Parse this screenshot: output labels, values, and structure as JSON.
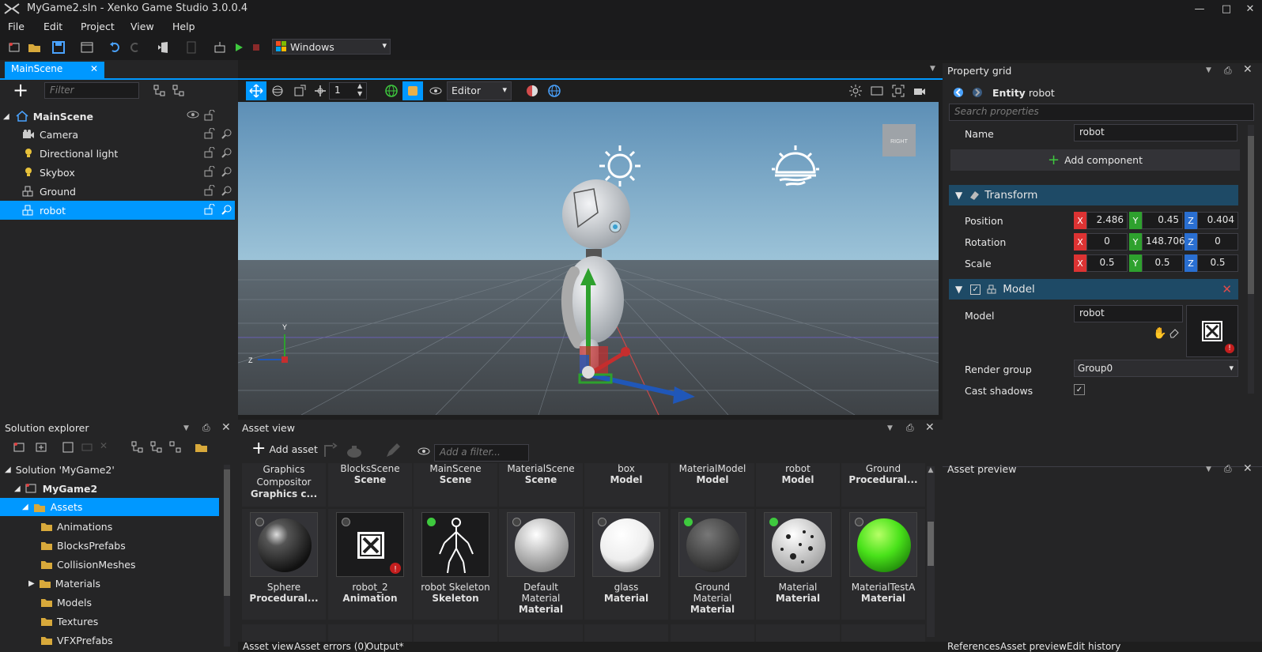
{
  "window": {
    "title": "MyGame2.sln - Xenko Game Studio 3.0.0.4"
  },
  "menu": [
    "File",
    "Edit",
    "Project",
    "View",
    "Help"
  ],
  "toolbar": {
    "platform": "Windows"
  },
  "doc_tab": {
    "label": "MainScene"
  },
  "scene_tree": {
    "filter_placeholder": "Filter",
    "root": "MainScene",
    "items": [
      "Camera",
      "Directional light",
      "Skybox",
      "Ground",
      "robot"
    ]
  },
  "viewport": {
    "grid_step": "1",
    "camera_mode": "Editor",
    "view_cube": "RIGHT",
    "gizmo": {
      "y": "Y",
      "z": "Z"
    }
  },
  "property_grid": {
    "title": "Property grid",
    "entity_label": "Entity",
    "entity_name": "robot",
    "search_placeholder": "Search properties",
    "name_label": "Name",
    "name_value": "robot",
    "add_component": "Add component",
    "transform": {
      "title": "Transform",
      "position_label": "Position",
      "rotation_label": "Rotation",
      "scale_label": "Scale",
      "x": "X",
      "y": "Y",
      "z": "Z",
      "position": [
        "2.486",
        "0.45",
        "0.404"
      ],
      "rotation": [
        "0",
        "148.706",
        "0"
      ],
      "scale": [
        "0.5",
        "0.5",
        "0.5"
      ]
    },
    "model": {
      "title": "Model",
      "model_label": "Model",
      "model_value": "robot",
      "render_group_label": "Render group",
      "render_group_value": "Group0",
      "cast_shadows_label": "Cast shadows"
    }
  },
  "solution_explorer": {
    "title": "Solution explorer",
    "solution": "Solution 'MyGame2'",
    "project": "MyGame2",
    "assets": "Assets",
    "folders": [
      "Animations",
      "BlocksPrefabs",
      "CollisionMeshes",
      "Materials",
      "Models",
      "Textures",
      "VFXPrefabs"
    ]
  },
  "asset_view": {
    "title": "Asset view",
    "add_asset": "Add asset",
    "filter_placeholder": "Add a filter...",
    "row1": [
      {
        "name": "Graphics Compositor",
        "type": "Graphics c..."
      },
      {
        "name": "BlocksScene",
        "type": "Scene"
      },
      {
        "name": "MainScene",
        "type": "Scene"
      },
      {
        "name": "MaterialScene",
        "type": "Scene"
      },
      {
        "name": "box",
        "type": "Model"
      },
      {
        "name": "MaterialModel",
        "type": "Model"
      },
      {
        "name": "robot",
        "type": "Model"
      },
      {
        "name": "Ground",
        "type": "Procedural..."
      }
    ],
    "row2": [
      {
        "name": "Sphere",
        "type": "Procedural..."
      },
      {
        "name": "robot_2",
        "type": "Animation"
      },
      {
        "name": "robot Skeleton",
        "type": "Skeleton"
      },
      {
        "name": "Default Material",
        "type": "Material"
      },
      {
        "name": "glass",
        "type": "Material"
      },
      {
        "name": "Ground Material",
        "type": "Material"
      },
      {
        "name": "Material",
        "type": "Material"
      },
      {
        "name": "MaterialTestA",
        "type": "Material"
      }
    ]
  },
  "asset_preview": {
    "title": "Asset preview"
  },
  "bottom_tabs_left": [
    "Asset view",
    "Asset errors (0)",
    "Output*"
  ],
  "bottom_tabs_right": [
    "References",
    "Asset preview",
    "Edit history"
  ]
}
